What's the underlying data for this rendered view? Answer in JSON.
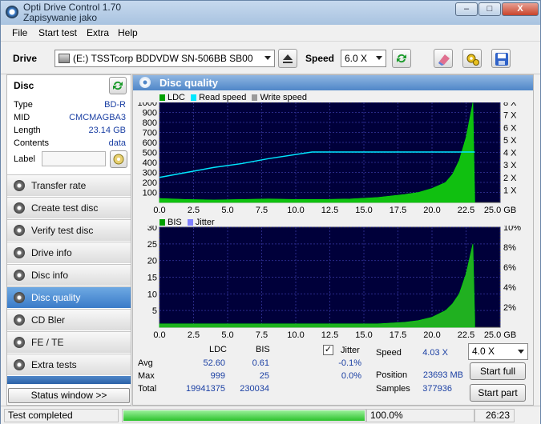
{
  "window": {
    "title_line1": "Opti Drive Control 1.70",
    "title_line2": "Zapisywanie jako",
    "min": "–",
    "max": "□",
    "close": "X"
  },
  "menu": [
    "File",
    "Start test",
    "Extra",
    "Help"
  ],
  "toolbar": {
    "drive_label": "Drive",
    "drive_value": "(E:)  TSSTcorp BDDVDW SN-506BB SB00",
    "speed_label": "Speed",
    "speed_value": "6.0 X"
  },
  "disc": {
    "title": "Disc",
    "fields": [
      {
        "label": "Type",
        "value": "BD-R"
      },
      {
        "label": "MID",
        "value": "CMCMAGBA3"
      },
      {
        "label": "Length",
        "value": "23.14 GB"
      },
      {
        "label": "Contents",
        "value": "data"
      }
    ],
    "label_label": "Label",
    "label_value": ""
  },
  "nav": [
    "Transfer rate",
    "Create test disc",
    "Verify test disc",
    "Drive info",
    "Disc info",
    "Disc quality",
    "CD Bler",
    "FE / TE",
    "Extra tests"
  ],
  "nav_active": "Disc quality",
  "status_window_button": "Status window >>",
  "panel_title": "Disc quality",
  "chart_data": [
    {
      "type": "area",
      "legend": [
        "LDC",
        "Read speed",
        "Write speed"
      ],
      "legend_colors": [
        "#00a000",
        "#00e8ff",
        "#9a9a9a"
      ],
      "x_ticks": [
        "0.0",
        "2.5",
        "5.0",
        "7.5",
        "10.0",
        "12.5",
        "15.0",
        "17.5",
        "20.0",
        "22.5",
        "25.0 GB"
      ],
      "y_ticks_left": [
        "1000",
        "900",
        "800",
        "700",
        "600",
        "500",
        "400",
        "300",
        "200",
        "100"
      ],
      "y_ticks_right": [
        "8 X",
        "7 X",
        "6 X",
        "5 X",
        "4 X",
        "3 X",
        "2 X",
        "1 X"
      ],
      "xlim": [
        0,
        25
      ],
      "ylim": [
        0,
        1000
      ],
      "y2lim": [
        0,
        8
      ],
      "series": [
        {
          "name": "LDC",
          "x": [
            0,
            2,
            4,
            6,
            8,
            10,
            12,
            14,
            16,
            18,
            19,
            20,
            21,
            21.5,
            22,
            22.5,
            23,
            23.14
          ],
          "values": [
            40,
            30,
            25,
            30,
            35,
            30,
            30,
            35,
            50,
            80,
            100,
            140,
            200,
            280,
            420,
            650,
            999,
            20
          ]
        },
        {
          "name": "Read speed",
          "x": [
            0,
            2,
            4,
            6,
            8,
            11,
            11.2,
            23,
            23.14
          ],
          "values": [
            2.0,
            2.4,
            2.8,
            3.1,
            3.5,
            4.0,
            4.03,
            4.03,
            4.03
          ]
        }
      ]
    },
    {
      "type": "area",
      "legend": [
        "BIS",
        "Jitter"
      ],
      "legend_colors": [
        "#00a000",
        "#8080ff"
      ],
      "x_ticks": [
        "0.0",
        "2.5",
        "5.0",
        "7.5",
        "10.0",
        "12.5",
        "15.0",
        "17.5",
        "20.0",
        "22.5",
        "25.0 GB"
      ],
      "y_ticks_left": [
        "30",
        "25",
        "20",
        "15",
        "10",
        "5"
      ],
      "y_ticks_right": [
        "10%",
        "8%",
        "6%",
        "4%",
        "2%"
      ],
      "xlim": [
        0,
        25
      ],
      "ylim": [
        0,
        30
      ],
      "y2lim": [
        0,
        10
      ],
      "series": [
        {
          "name": "BIS",
          "x": [
            0,
            4,
            8,
            12,
            16,
            18,
            19,
            20,
            21,
            21.5,
            22,
            22.5,
            23,
            23.14
          ],
          "values": [
            1,
            1,
            1,
            1,
            1,
            1.5,
            2,
            3,
            5,
            7,
            10,
            16,
            25,
            2
          ]
        }
      ]
    }
  ],
  "stats": {
    "col_ldc": "LDC",
    "col_bis": "BIS",
    "col_jitter": "Jitter",
    "rows": [
      {
        "label": "Avg",
        "ldc": "52.60",
        "bis": "0.61",
        "jitter": "-0.1%"
      },
      {
        "label": "Max",
        "ldc": "999",
        "bis": "25",
        "jitter": "0.0%"
      },
      {
        "label": "Total",
        "ldc": "19941375",
        "bis": "230034",
        "jitter": ""
      }
    ],
    "speed_label": "Speed",
    "speed_value": "4.03 X",
    "position_label": "Position",
    "position_value": "23693 MB",
    "samples_label": "Samples",
    "samples_value": "377936",
    "speed_select": "4.0 X",
    "start_full": "Start full",
    "start_part": "Start part"
  },
  "statusbar": {
    "text": "Test completed",
    "progress": 100.0,
    "progress_text": "100.0%",
    "time": "26:23"
  }
}
